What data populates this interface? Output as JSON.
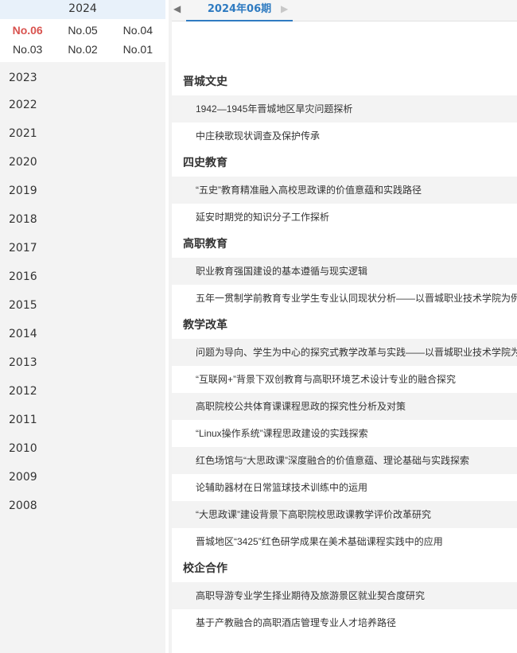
{
  "sidebar": {
    "current_year": "2024",
    "issues": [
      "No.06",
      "No.05",
      "No.04",
      "No.03",
      "No.02",
      "No.01"
    ],
    "active_issue": "No.06",
    "years": [
      "2023",
      "2022",
      "2021",
      "2020",
      "2019",
      "2018",
      "2017",
      "2016",
      "2015",
      "2014",
      "2013",
      "2012",
      "2011",
      "2010",
      "2009",
      "2008"
    ]
  },
  "main": {
    "prev_arrow": "◀",
    "next_arrow": "▶",
    "issue_tab": "2024年06期",
    "sections": [
      {
        "title": "晋城文史",
        "articles": [
          "1942—1945年晋城地区旱灾问题探析",
          "中庄秧歌现状调查及保护传承"
        ]
      },
      {
        "title": "四史教育",
        "articles": [
          "“五史”教育精准融入高校思政课的价值意蕴和实践路径",
          "延安时期党的知识分子工作探析"
        ]
      },
      {
        "title": "高职教育",
        "articles": [
          "职业教育强国建设的基本遵循与现实逻辑",
          "五年一贯制学前教育专业学生专业认同现状分析——以晋城职业技术学院为例"
        ]
      },
      {
        "title": "教学改革",
        "articles": [
          "问题为导向、学生为中心的探究式教学改革与实践——以晋城职业技术学院为例",
          "“互联网+”背景下双创教育与高职环境艺术设计专业的融合探究",
          "高职院校公共体育课课程思政的探究性分析及对策",
          "“Linux操作系统”课程思政建设的实践探索",
          "红色场馆与“大思政课”深度融合的价值意蕴、理论基础与实践探索",
          "论辅助器材在日常篮球技术训练中的运用",
          "“大思政课”建设背景下高职院校思政课教学评价改革研究",
          "晋城地区“3425”红色研学成果在美术基础课程实践中的应用"
        ]
      },
      {
        "title": "校企合作",
        "articles": [
          "高职导游专业学生择业期待及旅游景区就业契合度研究",
          "基于产教融合的高职酒店管理专业人才培养路径"
        ]
      }
    ]
  }
}
